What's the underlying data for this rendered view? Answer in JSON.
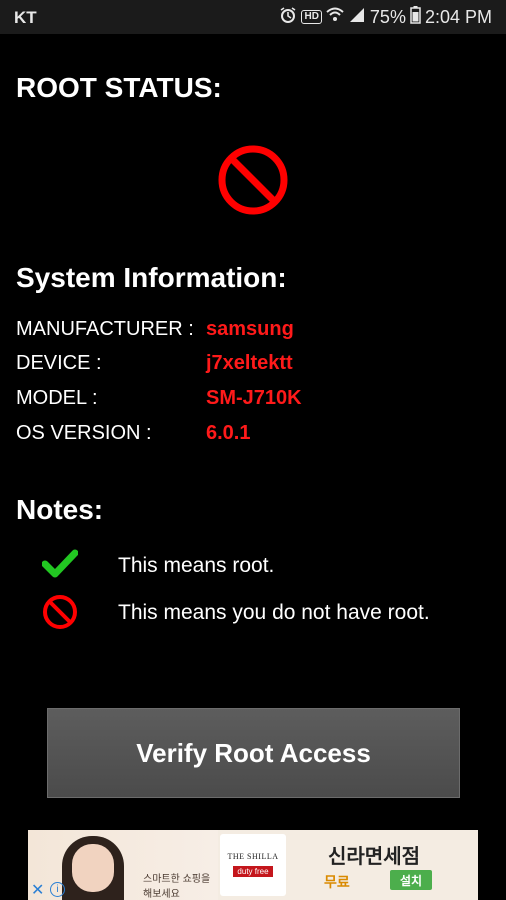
{
  "status_bar": {
    "carrier": "KT",
    "hd_label": "HD",
    "battery": "75%",
    "time": "2:04 PM"
  },
  "root_status": {
    "heading": "ROOT STATUS:",
    "state_icon": "no-root-icon",
    "state_color": "#ff0000"
  },
  "system_info": {
    "heading": "System Information:",
    "rows": [
      {
        "label": "MANUFACTURER :",
        "value": "samsung"
      },
      {
        "label": "DEVICE :",
        "value": "j7xeltektt"
      },
      {
        "label": "MODEL :",
        "value": "SM-J710K"
      },
      {
        "label": "OS VERSION :",
        "value": "6.0.1"
      }
    ],
    "value_color": "#ff1a1a"
  },
  "notes": {
    "heading": "Notes:",
    "items": [
      {
        "icon": "checkmark-icon",
        "color": "#22c722",
        "text": "This means root."
      },
      {
        "icon": "no-root-icon",
        "color": "#ff0000",
        "text": "This means you do not have root."
      }
    ]
  },
  "verify_button": {
    "label": "Verify Root Access"
  },
  "ad": {
    "slogan": "스마트한 쇼핑을 해보세요",
    "logo_top": "THE SHILLA",
    "logo_bottom": "duty free",
    "brand": "신라면세점",
    "free_label": "무료",
    "install_label": "설치",
    "close_symbol": "✕",
    "info_symbol": "i"
  }
}
